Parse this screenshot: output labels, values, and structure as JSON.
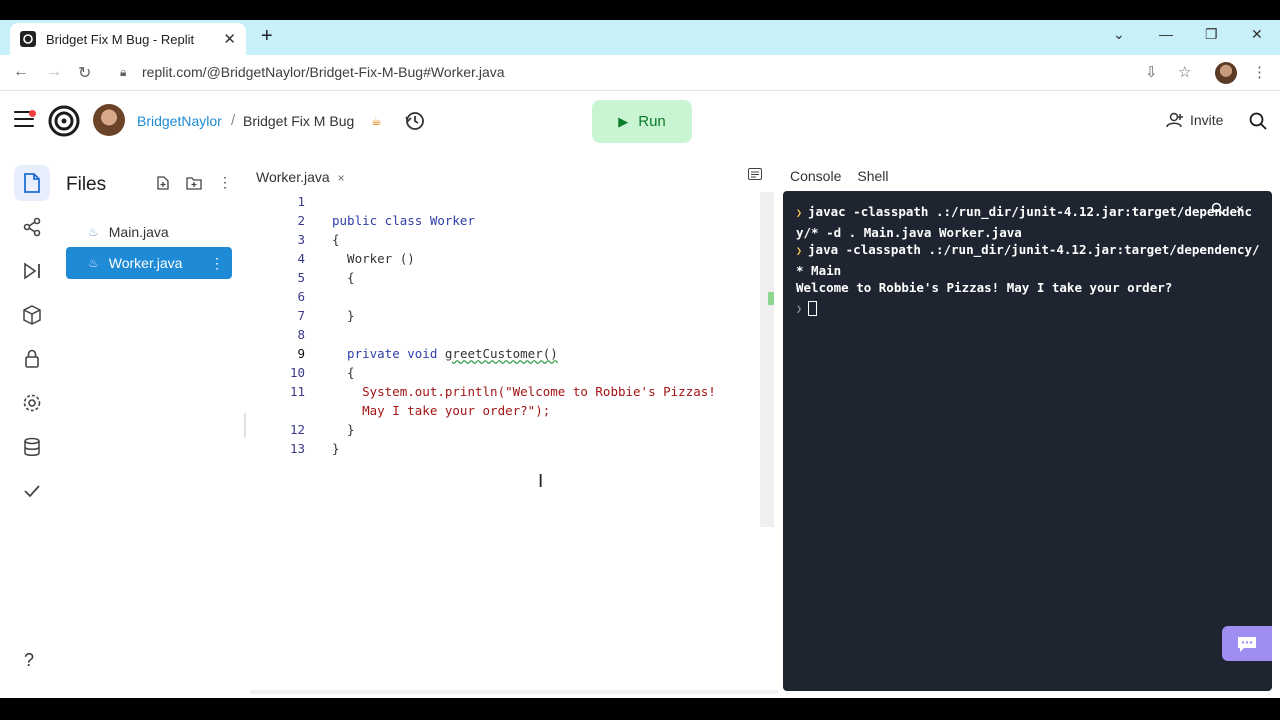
{
  "browser": {
    "tab_title": "Bridget Fix M Bug - Replit",
    "url": "replit.com/@BridgetNaylor/Bridget-Fix-M-Bug#Worker.java"
  },
  "header": {
    "username": "BridgetNaylor",
    "separator": "/",
    "repl_name": "Bridget Fix M Bug",
    "run_label": "Run",
    "invite_label": "Invite"
  },
  "files": {
    "title": "Files",
    "items": [
      {
        "name": "Main.java",
        "active": false
      },
      {
        "name": "Worker.java",
        "active": true
      }
    ]
  },
  "editor": {
    "tab_label": "Worker.java",
    "current_line": 9,
    "lines": [
      {
        "n": "1",
        "code": ""
      },
      {
        "n": "2",
        "code": "public class Worker"
      },
      {
        "n": "3",
        "code": "{"
      },
      {
        "n": "4",
        "code": "  Worker ()"
      },
      {
        "n": "5",
        "code": "  {"
      },
      {
        "n": "6",
        "code": ""
      },
      {
        "n": "7",
        "code": "  }"
      },
      {
        "n": "8",
        "code": ""
      },
      {
        "n": "9",
        "code": "  private void greetCustomer()"
      },
      {
        "n": "10",
        "code": "  {"
      },
      {
        "n": "11",
        "code": "    System.out.println(\"Welcome to Robbie's Pizzas!"
      },
      {
        "n": "",
        "code": "    May I take your order?\");"
      },
      {
        "n": "12",
        "code": "  }"
      },
      {
        "n": "13",
        "code": "}"
      }
    ]
  },
  "console": {
    "tabs": [
      "Console",
      "Shell"
    ],
    "lines": [
      {
        "prompt": true,
        "text": "javac -classpath .:/run_dir/junit-4.12.jar:target/dependency/* -d . Main.java Worker.java"
      },
      {
        "prompt": true,
        "text": "java -classpath .:/run_dir/junit-4.12.jar:target/dependency/* Main"
      },
      {
        "prompt": false,
        "text": "Welcome to Robbie's Pizzas! May I take your order?"
      }
    ]
  },
  "colors": {
    "accent": "#1f8bd6",
    "run_bg": "#c9f5d2",
    "run_text": "#0a7d2b",
    "console_bg": "#1e2430",
    "prompt": "#f5c453",
    "chat_btn": "#a08df2"
  },
  "icons": [
    "replit-logo",
    "history-icon",
    "files-icon",
    "git-icon",
    "debugger-icon",
    "packages-icon",
    "secrets-icon",
    "settings-icon",
    "database-icon",
    "tests-icon",
    "help-icon",
    "search-icon",
    "invite-icon",
    "chat-icon"
  ]
}
